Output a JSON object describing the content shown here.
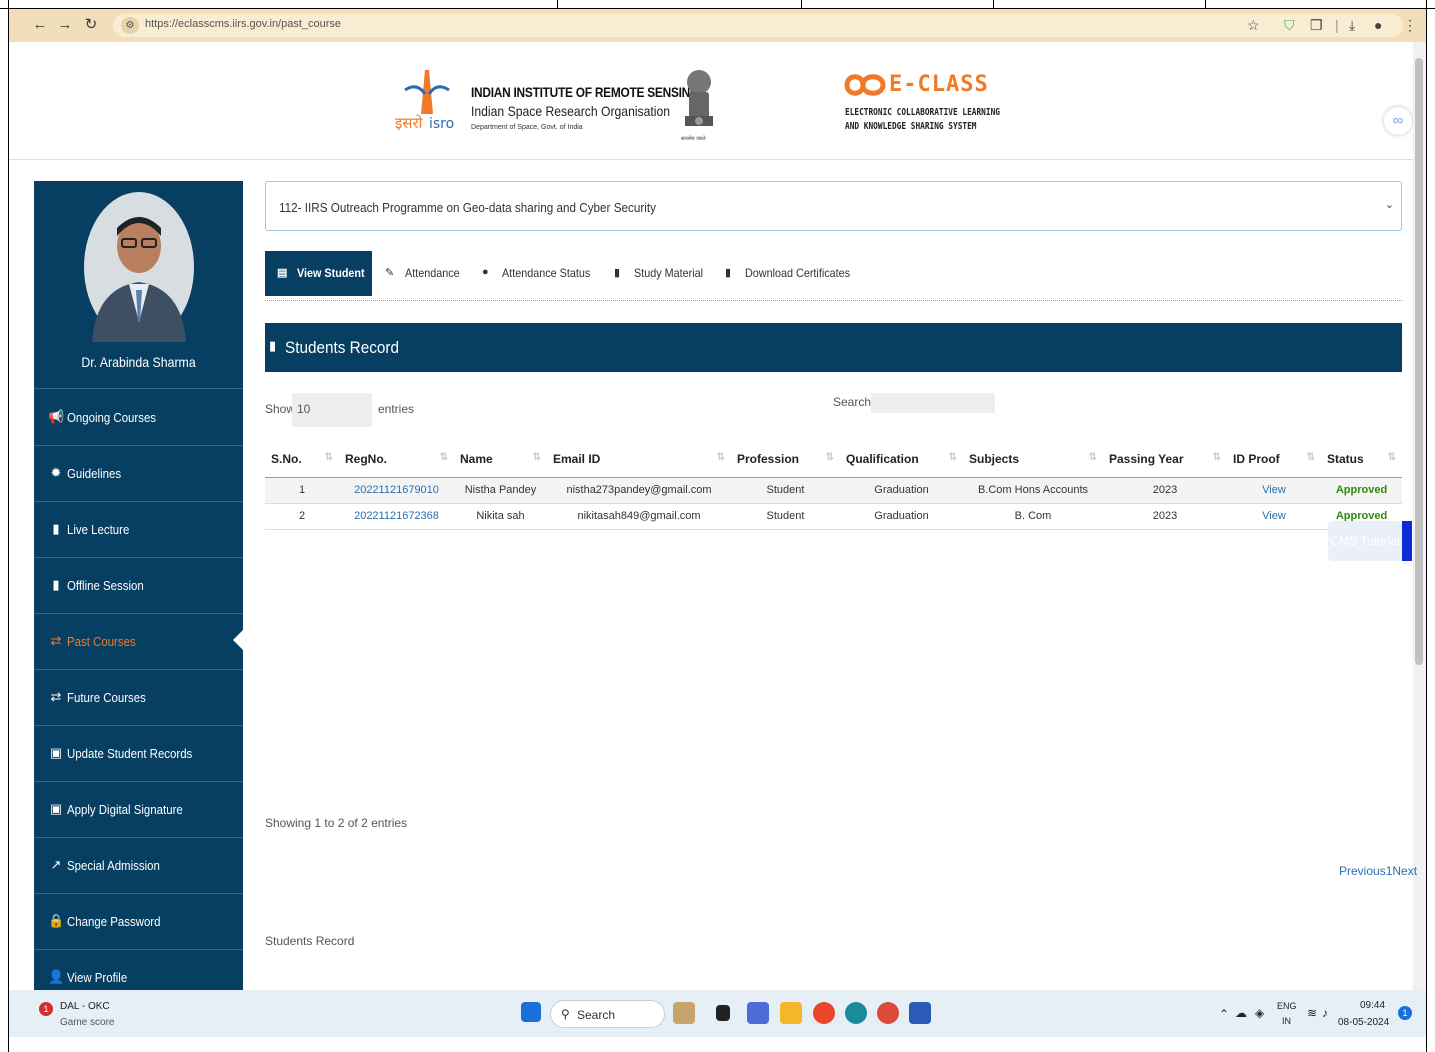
{
  "browser": {
    "url": "https://eclasscms.iirs.gov.in/past_course"
  },
  "header": {
    "isro_hindi": "इसरो",
    "isro_en": "isro",
    "iirs_title": "INDIAN INSTITUTE OF REMOTE SENSING",
    "iirs_subtitle": "Indian Space Research Organisation",
    "iirs_dept": "Department of Space, Govt. of India",
    "eclass_name": "E-CLASS",
    "eclass_sub1": "ELECTRONIC COLLABORATIVE LEARNING",
    "eclass_sub2": "AND KNOWLEDGE SHARING SYSTEM",
    "emblem_caption": "सत्यमेव जयते"
  },
  "sidebar": {
    "profile_name": "Dr. Arabinda Sharma",
    "items": [
      {
        "label": "Ongoing Courses",
        "icon": "megaphone-icon",
        "glyph": "📢"
      },
      {
        "label": "Guidelines",
        "icon": "gear-icon",
        "glyph": "✹"
      },
      {
        "label": "Live Lecture",
        "icon": "book-icon",
        "glyph": "▮"
      },
      {
        "label": "Offline Session",
        "icon": "book-icon",
        "glyph": "▮"
      },
      {
        "label": "Past Courses",
        "icon": "exchange-icon",
        "glyph": "⇄"
      },
      {
        "label": "Future Courses",
        "icon": "exchange-icon",
        "glyph": "⇄"
      },
      {
        "label": "Update Student Records",
        "icon": "id-card-icon",
        "glyph": "▣"
      },
      {
        "label": "Apply Digital Signature",
        "icon": "id-card-icon",
        "glyph": "▣"
      },
      {
        "label": "Special Admission",
        "icon": "external-link-icon",
        "glyph": "↗"
      },
      {
        "label": "Change Password",
        "icon": "lock-icon",
        "glyph": "🔒"
      },
      {
        "label": "View Profile",
        "icon": "user-icon",
        "glyph": "👤"
      }
    ],
    "active_index": 4
  },
  "main": {
    "course_selected": "112- IIRS Outreach Programme on Geo-data sharing and Cyber Security",
    "tabs": [
      {
        "label": "View Student",
        "icon": "table-icon",
        "glyph": "▤"
      },
      {
        "label": "Attendance",
        "icon": "pencil-icon",
        "glyph": "✎"
      },
      {
        "label": "Attendance Status",
        "icon": "info-icon",
        "glyph": "●"
      },
      {
        "label": "Study Material",
        "icon": "book-icon",
        "glyph": "▮"
      },
      {
        "label": "Download Certificates",
        "icon": "book-icon",
        "glyph": "▮"
      }
    ],
    "records_title": "Students Record",
    "show_label": "Show",
    "show_value": "10",
    "entries_label": "entries",
    "search_label": "Search:",
    "columns": [
      "S.No.",
      "RegNo.",
      "Name",
      "Email ID",
      "Profession",
      "Qualification",
      "Subjects",
      "Passing Year",
      "ID Proof",
      "Status"
    ],
    "rows": [
      [
        "1",
        "20221121679010",
        "Nistha Pandey",
        "nistha273pandey@gmail.com",
        "Student",
        "Graduation",
        "B.Com Hons Accounts",
        "2023",
        "View",
        "Approved"
      ],
      [
        "2",
        "20221121672368",
        "Nikita sah",
        "nikitasah849@gmail.com",
        "Student",
        "Graduation",
        "B. Com",
        "2023",
        "View",
        "Approved"
      ]
    ],
    "cms_tutorial": "CMS Tutorial",
    "showing": "Showing 1 to 2 of 2 entries",
    "pager": {
      "previous": "Previous",
      "page": "1",
      "next": "Next"
    },
    "footer_label": "Students Record"
  },
  "taskbar": {
    "weather_title": "DAL - OKC",
    "weather_sub": "Game score",
    "badge": "1",
    "search": "Search",
    "lang": "ENG",
    "region": "IN",
    "time": "09:44",
    "date": "08-05-2024",
    "notif": "1"
  },
  "colors": {
    "navy": "#073f63",
    "accent_orange": "#f07a28",
    "approved_green": "#2e8b0f",
    "link_blue": "#2a6db3"
  }
}
